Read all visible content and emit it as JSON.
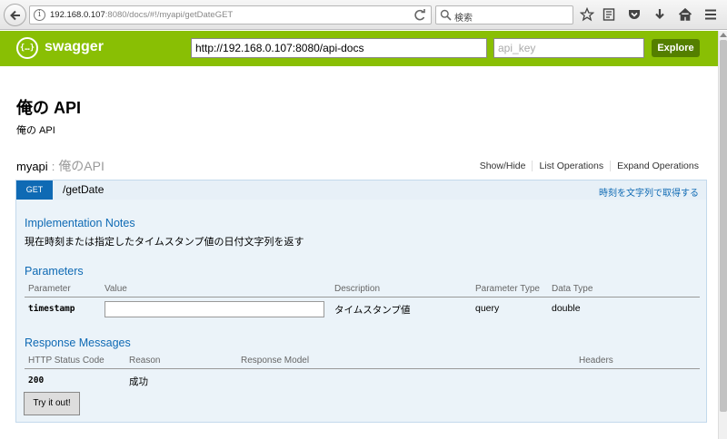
{
  "browser": {
    "url_host": "192.168.0.107",
    "url_rest": ":8080/docs/#!/myapi/getDateGET",
    "search_placeholder": "検索"
  },
  "header": {
    "logo_mark": "{…}",
    "logo_text": "swagger",
    "api_url_value": "http://192.168.0.107:8080/api-docs",
    "api_key_placeholder": "api_key",
    "explore_label": "Explore",
    "colors": {
      "bar": "#89bf04",
      "explore": "#547f00"
    }
  },
  "api": {
    "title": "俺の API",
    "description": "俺の API"
  },
  "resource": {
    "name": "myapi",
    "separator": ":",
    "title": "俺のAPI",
    "links": [
      "Show/Hide",
      "List Operations",
      "Expand Operations"
    ]
  },
  "operation": {
    "method": "GET",
    "path": "/getDate",
    "summary": "時刻を文字列で取得する",
    "implementation_notes_title": "Implementation Notes",
    "implementation_notes": "現在時刻または指定したタイムスタンプ値の日付文字列を返す",
    "parameters_title": "Parameters",
    "parameter_headers": {
      "parameter": "Parameter",
      "value": "Value",
      "description": "Description",
      "parameter_type": "Parameter Type",
      "data_type": "Data Type"
    },
    "parameters": [
      {
        "name": "timestamp",
        "value": "",
        "description": "タイムスタンプ値",
        "type": "query",
        "data_type": "double"
      }
    ],
    "response_messages_title": "Response Messages",
    "response_headers": {
      "status": "HTTP Status Code",
      "reason": "Reason",
      "model": "Response Model",
      "headers": "Headers"
    },
    "responses": [
      {
        "code": "200",
        "reason": "成功",
        "model": "",
        "headers": ""
      }
    ],
    "try_button_label": "Try it out!",
    "method_color": "#0f6ab4"
  }
}
